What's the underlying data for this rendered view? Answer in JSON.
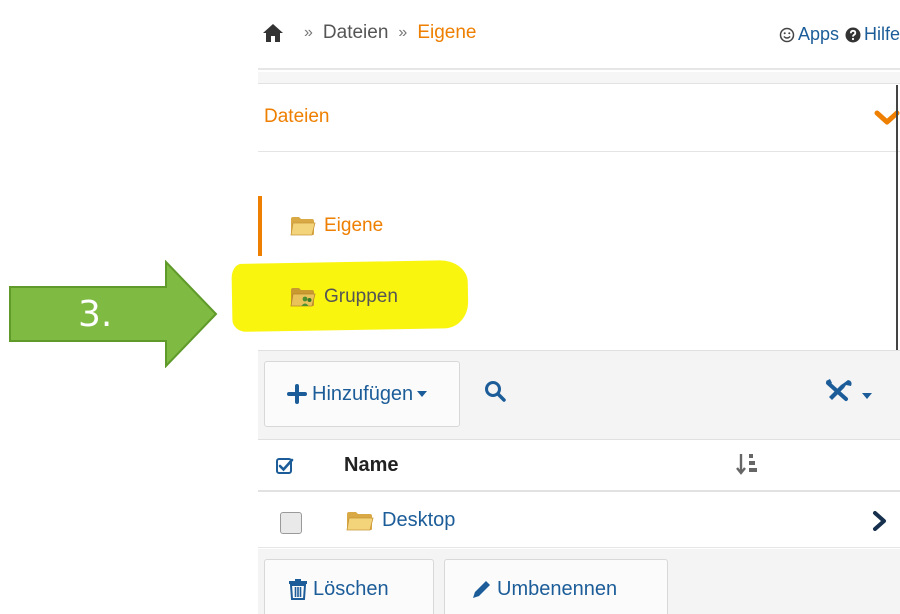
{
  "breadcrumb": {
    "home_icon": "home-icon",
    "items": [
      "Dateien",
      "Eigene"
    ],
    "separator": "»"
  },
  "top_links": {
    "apps_label": "Apps",
    "apps_icon": "smiley-icon",
    "help_label": "Hilfe",
    "help_icon": "question-circle-icon"
  },
  "panel": {
    "title": "Dateien",
    "toggle_icon": "chevron-down-icon"
  },
  "folders": [
    {
      "label": "Eigene",
      "icon": "folder-icon",
      "active": true
    },
    {
      "label": "Gruppen",
      "icon": "group-folder-icon",
      "active": false
    }
  ],
  "annotation": {
    "step_label": "3."
  },
  "toolbar": {
    "add_label": "Hinzufügen",
    "search_icon": "search-icon",
    "tools_icon": "wrench-screwdriver-icon"
  },
  "table": {
    "columns": [
      "Name"
    ],
    "rows": [
      {
        "name": "Desktop",
        "icon": "folder-icon"
      }
    ]
  },
  "actions": {
    "delete_label": "Löschen",
    "rename_label": "Umbenennen"
  },
  "colors": {
    "accent_orange": "#ee7f00",
    "link_blue": "#1c5d99",
    "highlight_yellow": "#f9f50f",
    "arrow_green": "#7fba42"
  }
}
